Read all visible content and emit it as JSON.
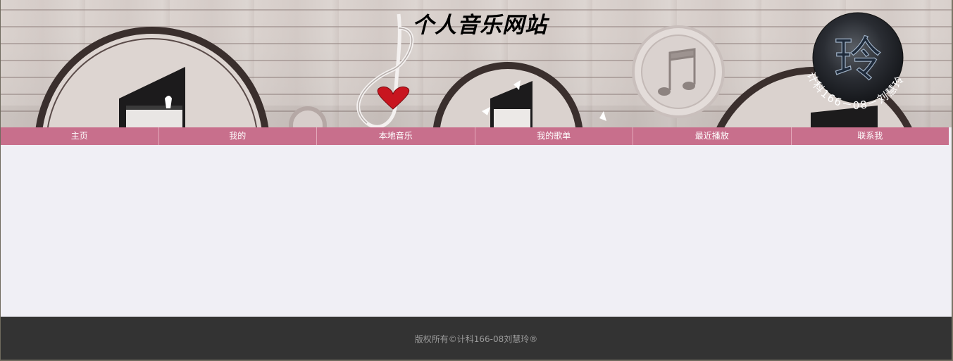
{
  "header": {
    "title": "个人音乐网站",
    "logo": {
      "monogram": "玲",
      "ring_text": "计科166－08－刘慧玲",
      "icon": "circular-logo-icon"
    },
    "banner_icon": "music-wall-banner-image"
  },
  "nav": {
    "items": [
      {
        "label": "主页"
      },
      {
        "label": "我的"
      },
      {
        "label": "本地音乐"
      },
      {
        "label": "我的歌单"
      },
      {
        "label": "最近播放"
      },
      {
        "label": "联系我"
      }
    ]
  },
  "footer": {
    "text": "版权所有©计科166-08刘慧玲®"
  },
  "colors": {
    "nav_bg": "#c86f8c",
    "content_bg": "#f0eff5",
    "footer_bg": "#333333",
    "footer_text": "#9c9c9c"
  }
}
